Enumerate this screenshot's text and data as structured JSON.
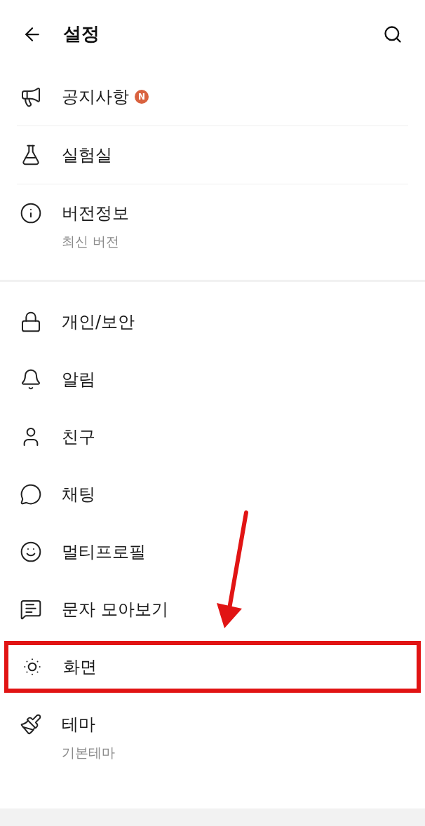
{
  "header": {
    "title": "설정"
  },
  "sections": [
    {
      "items": [
        {
          "label": "공지사항",
          "badge": "N",
          "highlighted": false
        },
        {
          "label": "실험실",
          "highlighted": false
        },
        {
          "label": "버전정보",
          "subtitle": "최신 버전",
          "highlighted": false
        }
      ]
    },
    {
      "items": [
        {
          "label": "개인/보안",
          "highlighted": false
        },
        {
          "label": "알림",
          "highlighted": false
        },
        {
          "label": "친구",
          "highlighted": false
        },
        {
          "label": "채팅",
          "highlighted": false
        },
        {
          "label": "멀티프로필",
          "highlighted": false
        },
        {
          "label": "문자 모아보기",
          "highlighted": false
        },
        {
          "label": "화면",
          "highlighted": true
        },
        {
          "label": "테마",
          "subtitle": "기본테마",
          "highlighted": false
        }
      ]
    }
  ],
  "annotation": {
    "arrow": true
  }
}
